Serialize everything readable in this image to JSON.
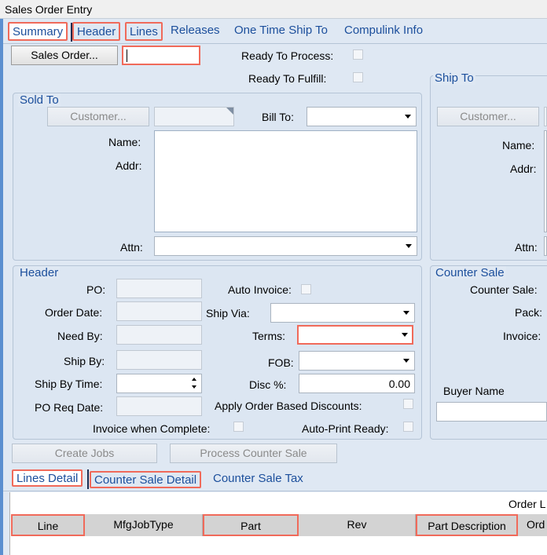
{
  "window": {
    "title": "Sales Order Entry"
  },
  "main_tabs": [
    {
      "label": "Summary"
    },
    {
      "label": "Header"
    },
    {
      "label": "Lines"
    },
    {
      "label": "Releases"
    },
    {
      "label": "One Time Ship To"
    },
    {
      "label": "Compulink Info"
    }
  ],
  "toolbar": {
    "sales_order_button": "Sales Order...",
    "sales_order_value": "",
    "ready_to_process_label": "Ready To Process:",
    "ready_to_fulfill_label": "Ready To Fulfill:"
  },
  "sold_to": {
    "title": "Sold To",
    "customer_button": "Customer...",
    "bill_to_label": "Bill To:",
    "name_label": "Name:",
    "addr_label": "Addr:",
    "attn_label": "Attn:"
  },
  "ship_to": {
    "title": "Ship To",
    "customer_button": "Customer...",
    "name_label": "Name:",
    "addr_label": "Addr:",
    "attn_label": "Attn:"
  },
  "header": {
    "title": "Header",
    "po_label": "PO:",
    "auto_invoice_label": "Auto Invoice:",
    "order_date_label": "Order Date:",
    "ship_via_label": "Ship Via:",
    "need_by_label": "Need By:",
    "terms_label": "Terms:",
    "ship_by_label": "Ship By:",
    "fob_label": "FOB:",
    "ship_by_time_label": "Ship By Time:",
    "disc_label": "Disc %:",
    "disc_value": "0.00",
    "po_req_date_label": "PO Req Date:",
    "apply_discounts_label": "Apply Order Based Discounts:",
    "invoice_complete_label": "Invoice when Complete:",
    "auto_print_label": "Auto-Print Ready:"
  },
  "counter_sale": {
    "title": "Counter Sale",
    "counter_sale_label": "Counter Sale:",
    "pack_label": "Pack:",
    "invoice_label": "Invoice:",
    "buyer_name_label": "Buyer Name"
  },
  "actions": {
    "create_jobs": "Create Jobs",
    "process_counter_sale": "Process Counter Sale"
  },
  "detail_tabs": [
    {
      "label": "Lines Detail"
    },
    {
      "label": "Counter Sale Detail"
    },
    {
      "label": "Counter Sale Tax"
    }
  ],
  "grid": {
    "caption": "Order L",
    "columns": [
      "Line",
      "MfgJobType",
      "Part",
      "Rev",
      "Part Description",
      "Ord"
    ]
  }
}
